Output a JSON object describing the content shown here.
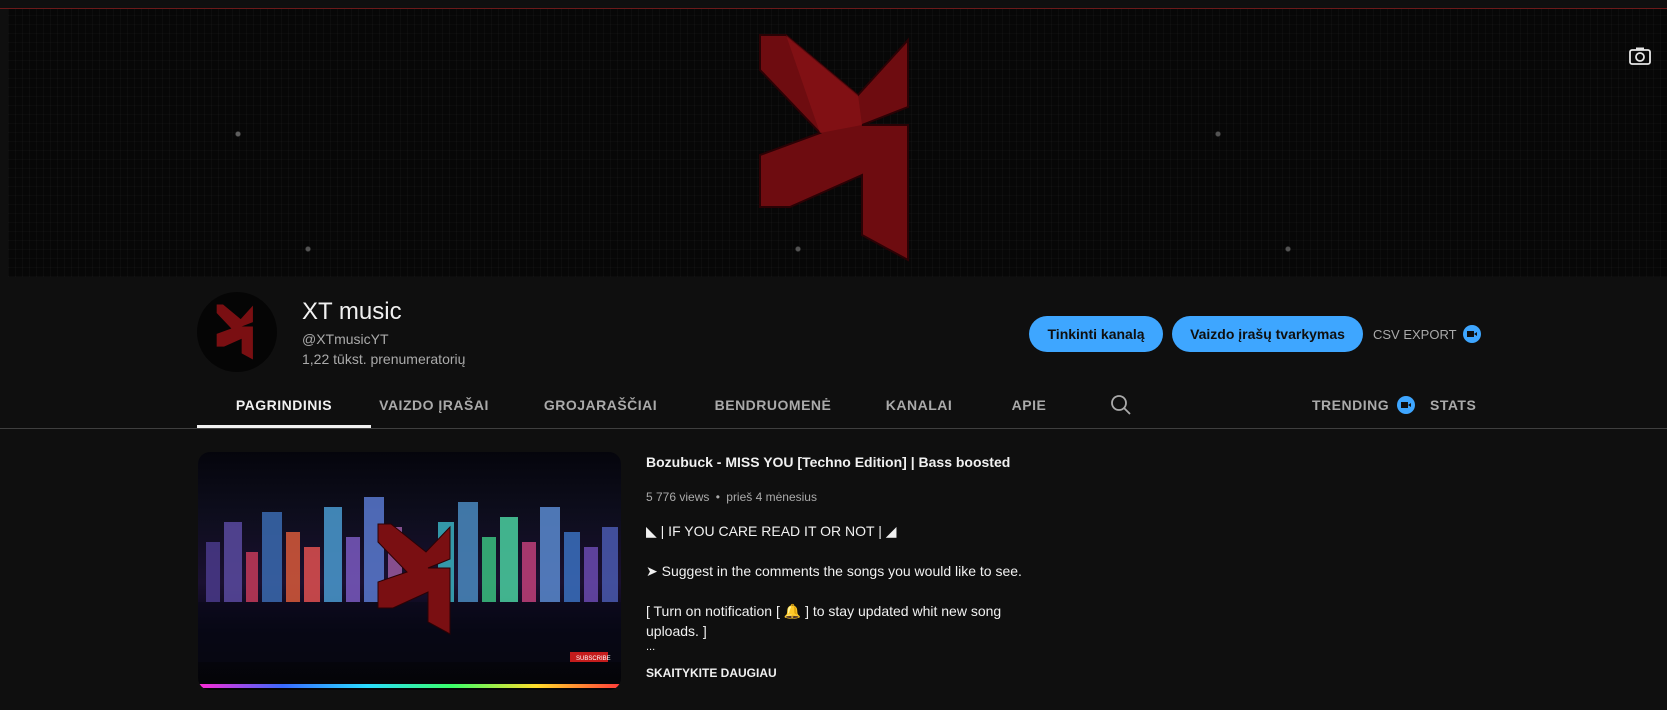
{
  "channel": {
    "name": "XT music",
    "handle": "@XTmusicYT",
    "subscribers": "1,22 tūkst. prenumeratorių"
  },
  "actions": {
    "customize_label": "Tinkinti kanalą",
    "manage_label": "Vaizdo įrašų tvarkymas",
    "csv_label": "CSV EXPORT"
  },
  "tabs": [
    {
      "label": "PAGRINDINIS",
      "active": true
    },
    {
      "label": "VAIZDO ĮRAŠAI",
      "active": false
    },
    {
      "label": "GROJARAŠČIAI",
      "active": false
    },
    {
      "label": "BENDRUOMENĖ",
      "active": false
    },
    {
      "label": "KANALAI",
      "active": false
    },
    {
      "label": "APIE",
      "active": false
    }
  ],
  "extension_tabs": {
    "trending": "TRENDING",
    "stats": "STATS"
  },
  "featured_video": {
    "title": "Bozubuck - MISS YOU [Techno Edition] | Bass boosted",
    "views": "5 776 views",
    "age": "prieš 4 mėnesius",
    "separator": "•",
    "description_lines": [
      "◣ | IF YOU CARE READ IT OR NOT | ◢",
      "➤ Suggest in the comments the songs you would like to see.",
      "[ Turn on notification [ 🔔 ] to stay updated whit new song uploads. ]",
      "..."
    ],
    "read_more": "SKAITYKITE DAUGIAU",
    "subscribe_badge": "SUBSCRIBE"
  },
  "icons": {
    "camera": "camera-icon",
    "search": "search-icon",
    "extension": "extension-icon"
  },
  "colors": {
    "background": "#0f0f0f",
    "accent_blue": "#3ea6ff",
    "brand_red": "#7a0f0f",
    "text_secondary": "#aaaaaa"
  }
}
